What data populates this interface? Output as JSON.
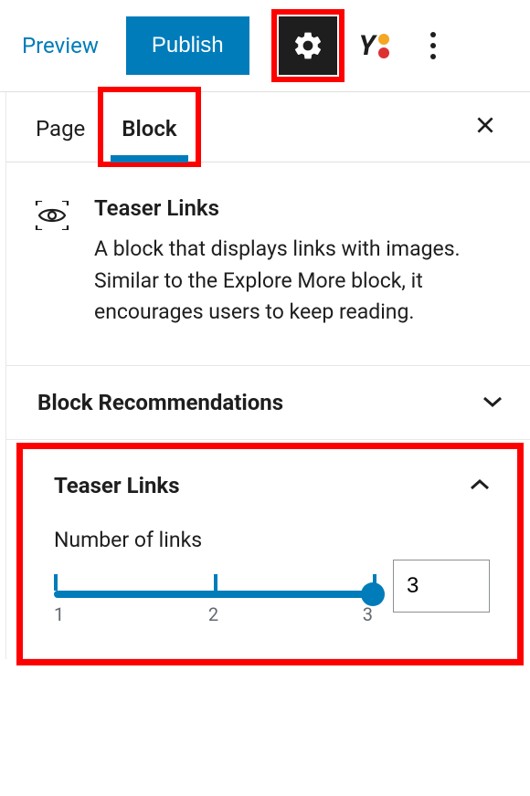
{
  "topbar": {
    "preview": "Preview",
    "publish": "Publish"
  },
  "tabs": {
    "page": "Page",
    "block": "Block"
  },
  "block": {
    "title": "Teaser Links",
    "description": "A block that displays links with images. Similar to the Explore More block, it encourages users to keep reading."
  },
  "panels": {
    "recommendations": "Block Recommendations",
    "teaser": {
      "title": "Teaser Links",
      "links_label": "Number of links",
      "links_value": "3",
      "slider_min": "1",
      "slider_mid": "2",
      "slider_max": "3"
    }
  }
}
